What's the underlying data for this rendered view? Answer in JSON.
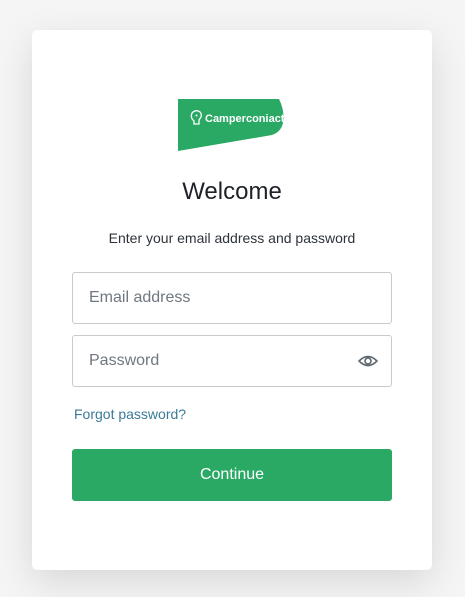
{
  "logo": {
    "brand_text": "Camperconiact",
    "icon": "camper-head-icon",
    "color": "#2aa965"
  },
  "header": {
    "title": "Welcome",
    "subtitle": "Enter your email address and password"
  },
  "form": {
    "email": {
      "value": "",
      "placeholder": "Email address"
    },
    "password": {
      "value": "",
      "placeholder": "Password",
      "toggle_icon": "eye-icon"
    },
    "forgot_label": "Forgot password?",
    "continue_label": "Continue"
  },
  "colors": {
    "accent": "#2aa965",
    "link": "#3a7a9a",
    "text": "#1e212a"
  }
}
